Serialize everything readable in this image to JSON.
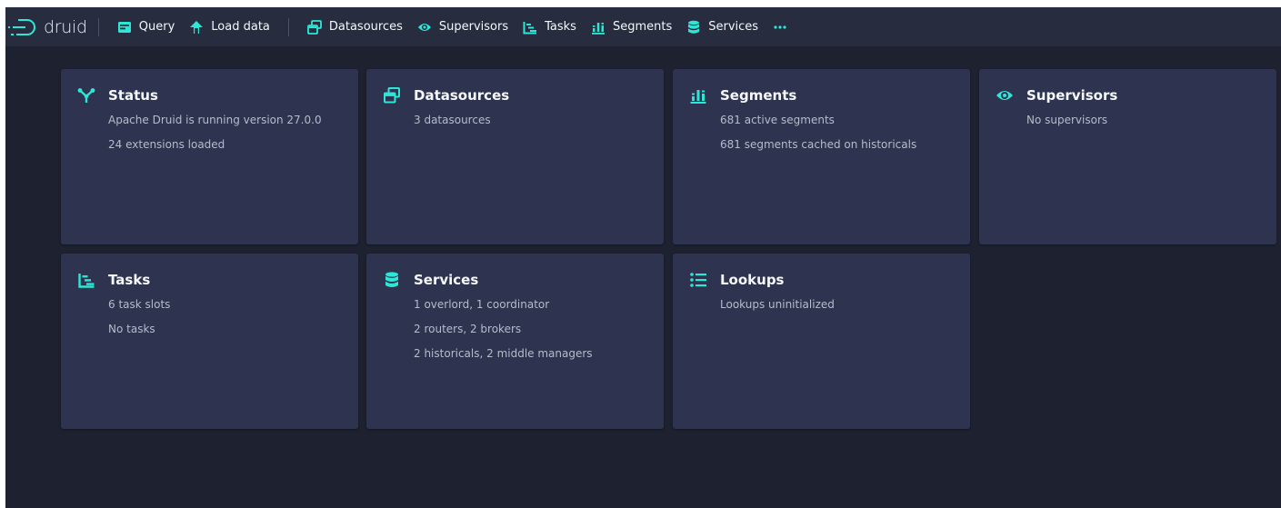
{
  "app": {
    "logo_text": "druid"
  },
  "nav": {
    "query_label": "Query",
    "load_data_label": "Load data",
    "datasources_label": "Datasources",
    "supervisors_label": "Supervisors",
    "tasks_label": "Tasks",
    "segments_label": "Segments",
    "services_label": "Services",
    "more_icon": "more-icon"
  },
  "colors": {
    "accent": "#2ee6d6",
    "background": "#1e2130",
    "navbar": "#272c3f",
    "card": "#2e3350"
  },
  "cards": {
    "status": {
      "title": "Status",
      "icon": "status-icon",
      "lines": [
        "Apache Druid is running version 27.0.0",
        "24 extensions loaded"
      ]
    },
    "datasources": {
      "title": "Datasources",
      "icon": "datasources-icon",
      "lines": [
        "3 datasources"
      ]
    },
    "segments": {
      "title": "Segments",
      "icon": "segments-icon",
      "lines": [
        "681 active segments",
        "681 segments cached on historicals"
      ]
    },
    "supervisors": {
      "title": "Supervisors",
      "icon": "eye-icon",
      "lines": [
        "No supervisors"
      ]
    },
    "tasks": {
      "title": "Tasks",
      "icon": "tasks-icon",
      "lines": [
        "6 task slots",
        "No tasks"
      ]
    },
    "services": {
      "title": "Services",
      "icon": "database-icon",
      "lines": [
        "1 overlord, 1 coordinator",
        "2 routers, 2 brokers",
        "2 historicals, 2 middle managers"
      ]
    },
    "lookups": {
      "title": "Lookups",
      "icon": "list-icon",
      "lines": [
        "Lookups uninitialized"
      ]
    }
  }
}
